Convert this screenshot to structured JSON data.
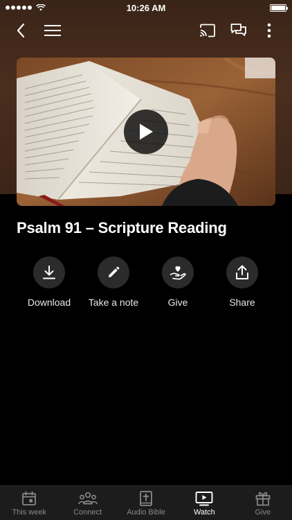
{
  "status_bar": {
    "time": "10:26 AM"
  },
  "video": {
    "title": "Psalm 91 – Scripture Reading"
  },
  "actions": [
    {
      "label": "Download",
      "icon": "download-icon"
    },
    {
      "label": "Take a note",
      "icon": "pencil-icon"
    },
    {
      "label": "Give",
      "icon": "give-heart-hand-icon"
    },
    {
      "label": "Share",
      "icon": "share-icon"
    }
  ],
  "tabs": [
    {
      "label": "This week",
      "icon": "calendar-icon",
      "active": false
    },
    {
      "label": "Connect",
      "icon": "people-icon",
      "active": false
    },
    {
      "label": "Audio Bible",
      "icon": "bible-icon",
      "active": false
    },
    {
      "label": "Watch",
      "icon": "play-screen-icon",
      "active": true
    },
    {
      "label": "Give",
      "icon": "gift-icon",
      "active": false
    }
  ],
  "colors": {
    "background": "#000000",
    "hero": "#4a2e1e",
    "action_circle": "#2b2b2b",
    "tab_bar": "#1c1c1c"
  }
}
